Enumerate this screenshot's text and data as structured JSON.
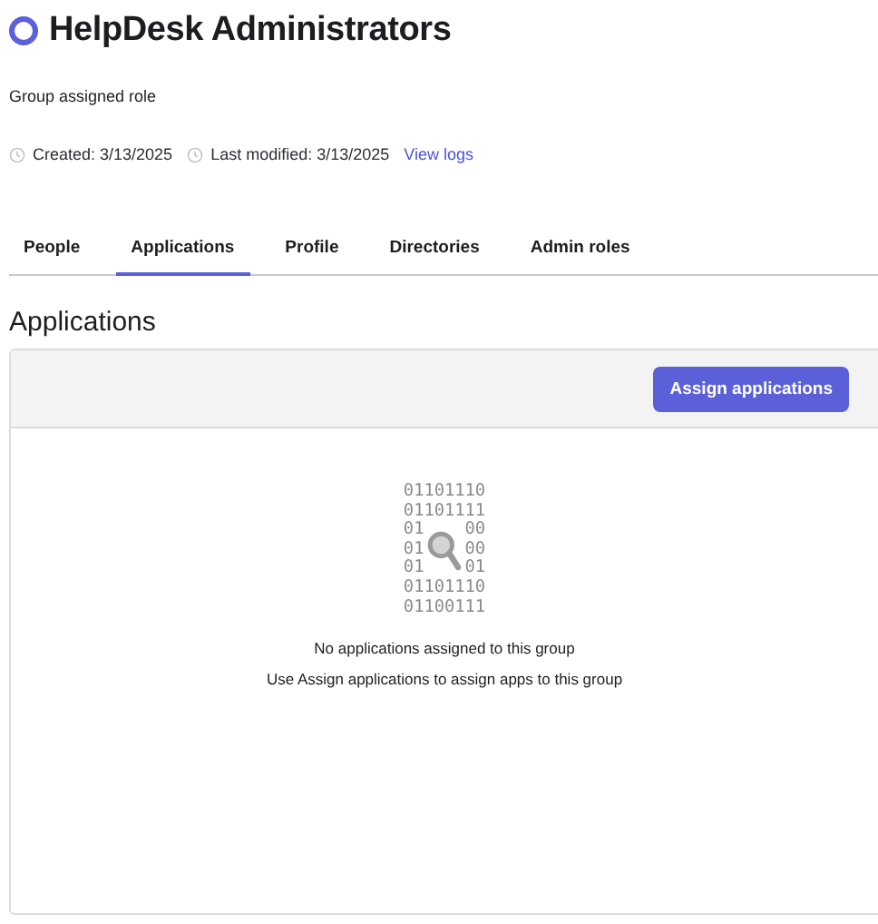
{
  "header": {
    "title": "HelpDesk Administrators",
    "subtitle": "Group assigned role",
    "created": "Created: 3/13/2025",
    "modified": "Last modified: 3/13/2025",
    "logs_link": "View logs"
  },
  "tabs": [
    {
      "label": "People",
      "selected": false
    },
    {
      "label": "Applications",
      "selected": true
    },
    {
      "label": "Profile",
      "selected": false
    },
    {
      "label": "Directories",
      "selected": false
    },
    {
      "label": "Admin roles",
      "selected": false
    }
  ],
  "section": {
    "heading": "Applications",
    "action_button": "Assign applications",
    "empty_state": {
      "binary_lines": [
        [
          "01101110"
        ],
        [
          "01101111"
        ],
        [
          "01",
          "00"
        ],
        [
          "01",
          "00"
        ],
        [
          "01",
          "01"
        ],
        [
          "01101110"
        ],
        [
          "01100111"
        ]
      ],
      "message": "No applications assigned to this group",
      "hint": "Use Assign applications to assign apps to this group"
    }
  }
}
